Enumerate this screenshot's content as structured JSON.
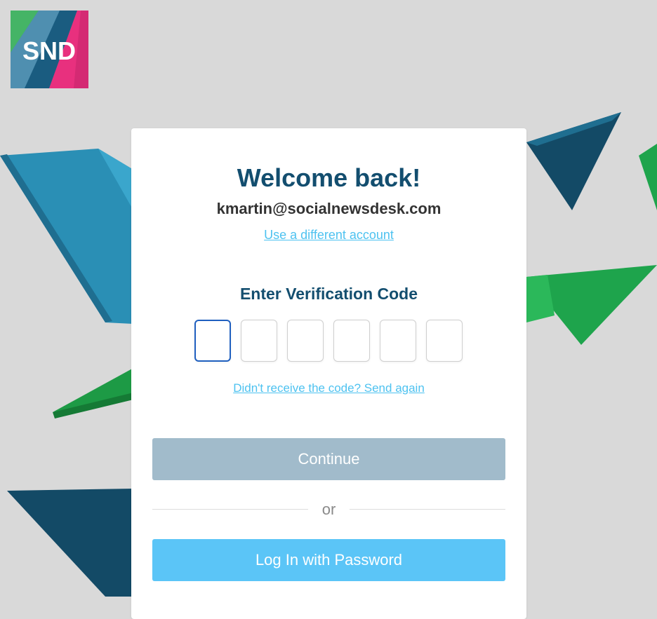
{
  "brand": {
    "logo_text": "SND"
  },
  "card": {
    "title": "Welcome back!",
    "email": "kmartin@socialnewsdesk.com",
    "different_account_link": "Use a different account",
    "code_label": "Enter Verification Code",
    "code_digits": [
      "",
      "",
      "",
      "",
      "",
      ""
    ],
    "resend_link": "Didn't receive the code? Send again",
    "continue_label": "Continue",
    "divider_text": "or",
    "password_login_label": "Log In with Password"
  },
  "colors": {
    "title": "#134e6f",
    "link": "#4dc2f0",
    "continue_disabled": "#a1bbcb",
    "password_button": "#5bc5f7",
    "active_input_border": "#1f5fbf",
    "background": "#d9d9d9"
  }
}
